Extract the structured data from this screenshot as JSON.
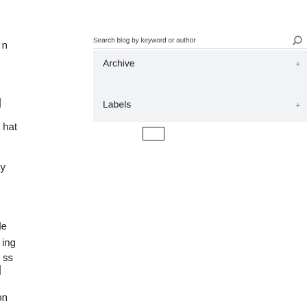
{
  "article": {
    "fragments": [
      "n",
      "hat",
      "ly",
      "le",
      "ing",
      "ss",
      "on"
    ]
  },
  "search": {
    "placeholder": "Search blog by keyword or author",
    "icon": "search-icon"
  },
  "sidebar": {
    "items": [
      {
        "label": "Archive",
        "icon": "plus-icon",
        "expand_glyph": "+"
      },
      {
        "label": "Labels",
        "icon": "plus-icon",
        "expand_glyph": "+"
      }
    ]
  },
  "colors": {
    "panel_bg": "#f1f3f4",
    "text": "#202124",
    "divider": "#dadce0"
  }
}
